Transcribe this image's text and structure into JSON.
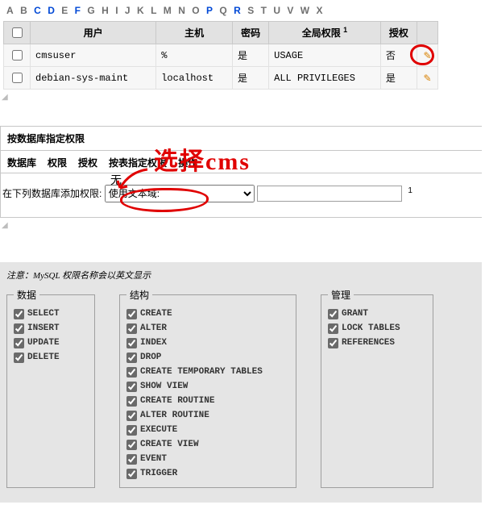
{
  "alphabet": {
    "letters": [
      "A",
      "B",
      "C",
      "D",
      "E",
      "F",
      "G",
      "H",
      "I",
      "J",
      "K",
      "L",
      "M",
      "N",
      "O",
      "P",
      "Q",
      "R",
      "S",
      "T",
      "U",
      "V",
      "W",
      "X"
    ],
    "active": [
      "C",
      "D",
      "F",
      "P",
      "R"
    ]
  },
  "users_table": {
    "headers": {
      "user": "用户",
      "host": "主机",
      "password": "密码",
      "global": "全局权限",
      "global_note": "1",
      "grant": "授权"
    },
    "rows": [
      {
        "user": "cmsuser",
        "host": "%",
        "pw": "是",
        "privs": "USAGE",
        "grant": "否"
      },
      {
        "user": "debian-sys-maint",
        "host": "localhost",
        "pw": "是",
        "privs": "ALL PRIVILEGES",
        "grant": "是"
      }
    ]
  },
  "dbpriv": {
    "header": "按数据库指定权限",
    "tabs": [
      "数据库",
      "权限",
      "授权",
      "按表指定权限",
      "操作"
    ],
    "none": "无",
    "add_label": "在下列数据库添加权限:",
    "select_value": "使用文本域:",
    "text_value": "",
    "note_one": "1"
  },
  "annotation": {
    "hand_text": "选择cms"
  },
  "privs": {
    "note": "注意：MySQL 权限名称会以英文显示",
    "groups": {
      "data": {
        "title": "数据",
        "items": [
          "SELECT",
          "INSERT",
          "UPDATE",
          "DELETE"
        ]
      },
      "struct": {
        "title": "结构",
        "items": [
          "CREATE",
          "ALTER",
          "INDEX",
          "DROP",
          "CREATE TEMPORARY TABLES",
          "SHOW VIEW",
          "CREATE ROUTINE",
          "ALTER ROUTINE",
          "EXECUTE",
          "CREATE VIEW",
          "EVENT",
          "TRIGGER"
        ]
      },
      "admin": {
        "title": "管理",
        "items": [
          "GRANT",
          "LOCK TABLES",
          "REFERENCES"
        ]
      }
    }
  }
}
